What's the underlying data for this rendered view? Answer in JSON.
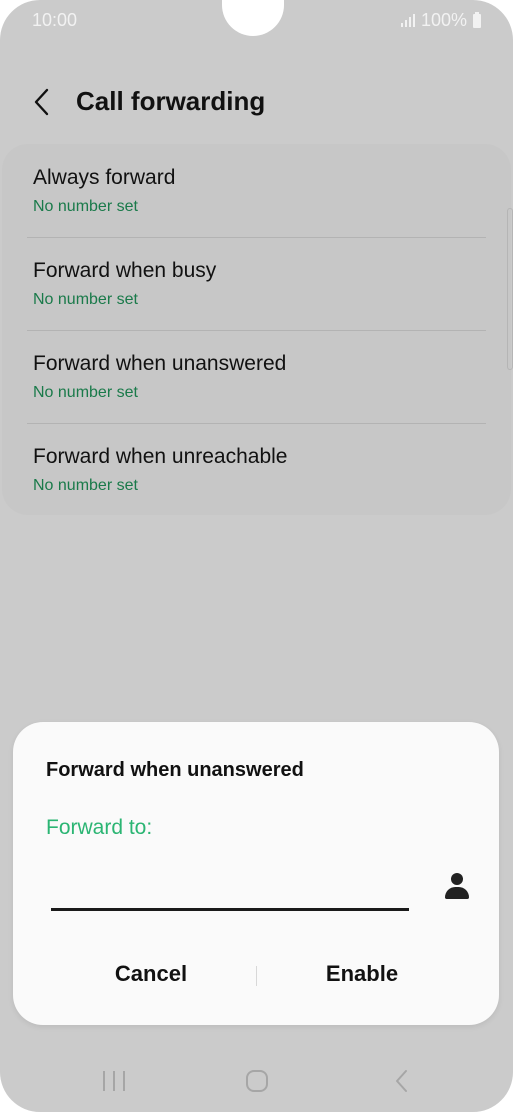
{
  "status_bar": {
    "time": "10:00",
    "battery": "100%"
  },
  "header": {
    "title": "Call forwarding"
  },
  "list": {
    "items": [
      {
        "title": "Always forward",
        "subtitle": "No number set"
      },
      {
        "title": "Forward when busy",
        "subtitle": "No number set"
      },
      {
        "title": "Forward when unanswered",
        "subtitle": "No number set"
      },
      {
        "title": "Forward when unreachable",
        "subtitle": "No number set"
      }
    ]
  },
  "dialog": {
    "title": "Forward when unanswered",
    "field_label": "Forward to:",
    "input_value": "",
    "cancel_label": "Cancel",
    "enable_label": "Enable"
  },
  "colors": {
    "accent": "#2bb573",
    "subtitle": "#1a7a4a",
    "background_dimmed": "#cbcbcb",
    "dialog_bg": "#fafafa"
  },
  "icons": {
    "back": "chevron-left-icon",
    "contact": "person-icon",
    "signal": "signal-icon",
    "battery": "battery-icon",
    "nav_recents": "recents-icon",
    "nav_home": "home-icon",
    "nav_back": "back-icon"
  }
}
